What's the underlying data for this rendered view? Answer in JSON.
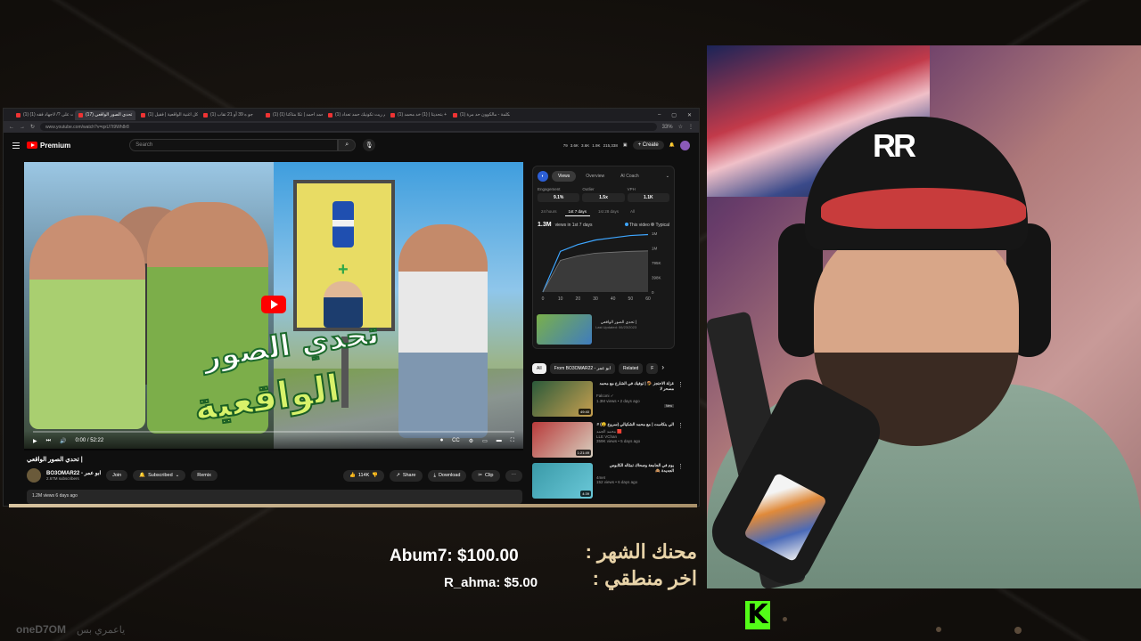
{
  "browser": {
    "tabs": [
      {
        "label": "(1) توقعات على ?/ لاجهاد فقه (1)",
        "active": false
      },
      {
        "label": "(17) تحدي الصور الواقعي",
        "active": true
      },
      {
        "label": "(1) تحدي كل اغنية الواقعية | فقيل",
        "active": false
      },
      {
        "label": "(1) جو ه 39 أو 21 تقاب",
        "active": false
      },
      {
        "label": "(1) جو محمد احمد | تكا متاكنا (1)",
        "active": false
      },
      {
        "label": "(1) عادتكم ريت تكونيك حمد تعداد",
        "active": false
      },
      {
        "label": "(1) القيام + بتحديتا | (1) خد محمد",
        "active": false
      },
      {
        "label": "(1) تحدي الكلمة - مالكوون حد مرة",
        "active": false
      }
    ],
    "url": "www.youtube.com/watch?v=qxU7t9Wh8r8",
    "zoom": "33%"
  },
  "youtube": {
    "logo_text": "Premium",
    "search_placeholder": "Search",
    "header_stats": [
      "79",
      "3.6K",
      "3.6K",
      "1.9K",
      "215,338"
    ],
    "create_label": "Create",
    "notification_count": "9+"
  },
  "video": {
    "title_line1": "تحدي الصور",
    "title_line2": "الواقعية",
    "time": "0:00 / 52:22",
    "progress_percent": 0,
    "page_title": "| تحدي الصور الواقعي",
    "channel_name": "BO3OMAR22 - ابو عمر",
    "channel_subs": "2.67M subscribers",
    "join_label": "Join",
    "subscribed_label": "Subscribed",
    "remix_label": "Remix",
    "likes": "114K",
    "share_label": "Share",
    "download_label": "Download",
    "clip_label": "Clip",
    "views_line": "1.2M views  6 days ago"
  },
  "analytics": {
    "tabs": [
      "Views",
      "Overview",
      "AI Coach"
    ],
    "active_tab": "Views",
    "metrics": [
      {
        "label": "Engagement",
        "value": "9.1%"
      },
      {
        "label": "Outlier",
        "value": "1.5x"
      },
      {
        "label": "VPH",
        "value": "1.1K"
      }
    ],
    "ranges": [
      "24 hours",
      "1st 7 days",
      "1st 28 days",
      "All"
    ],
    "active_range": "1st 7 days",
    "views_total": "1.3M",
    "views_caption": "views in 1st 7 days",
    "legend_this": "This video",
    "legend_typical": "Typical",
    "legend_this_color": "#3ea6ff",
    "legend_typical_color": "#777777",
    "chart_data": {
      "type": "area",
      "x": [
        0,
        10,
        20,
        30,
        40,
        50,
        60
      ],
      "series": [
        {
          "name": "This video",
          "values": [
            0,
            900000,
            1050000,
            1150000,
            1200000,
            1250000,
            1270000
          ]
        },
        {
          "name": "Typical",
          "values": [
            0,
            700000,
            800000,
            860000,
            880000,
            900000,
            910000
          ]
        }
      ],
      "y_ticks": [
        "1M",
        "1M",
        "795K",
        "398K",
        "0"
      ],
      "x_ticks": [
        "0",
        "10",
        "20",
        "30",
        "40",
        "50",
        "60"
      ]
    },
    "compare_video_title": "| تحدي الصور الواقعي",
    "compare_video_date": "Last Updated: 06/23/2023"
  },
  "filters": [
    "All",
    "From BO3OMAR22 - ابو عمر",
    "Related",
    "F"
  ],
  "recommendations": [
    {
      "title": "غزلة الاحتجز 🪤 | توفيك في الشارع مع محمد مسحر لا",
      "channel": "Falconi ✓",
      "meta": "1.3M views • 2 days ago",
      "badge": "New",
      "duration": "49:40",
      "color1": "#2b5a3a",
      "color2": "#c8a050"
    },
    {
      "title": "الي بنكاست | مع محمد الشكيالي (سروع 😮) #",
      "channel": "محمد الجمد 🟥",
      "meta": "LLE VChan",
      "meta2": "359K views • 5 days ago",
      "duration": "1:21:49",
      "color1": "#b83a3a",
      "color2": "#d8d0c0"
    },
    {
      "title": "يوم في الجامعة وصحاك تمثاله الكابوس الجديدة 🙈",
      "channel": "4met",
      "meta": "152 views • 6 days ago",
      "duration": "4:39",
      "color1": "#3a9aa8",
      "color2": "#6ac8d8"
    }
  ],
  "overlay": {
    "top_donor_label": "محنك الشهر :",
    "top_donor": "Abum7: $100.00",
    "last_donor_label": "اخر منطقي :",
    "last_donor": "R_ahma: $5.00",
    "watermark": "oneD7OM",
    "watermark_ar": "ياعمري بس",
    "kick_letter": "K"
  }
}
